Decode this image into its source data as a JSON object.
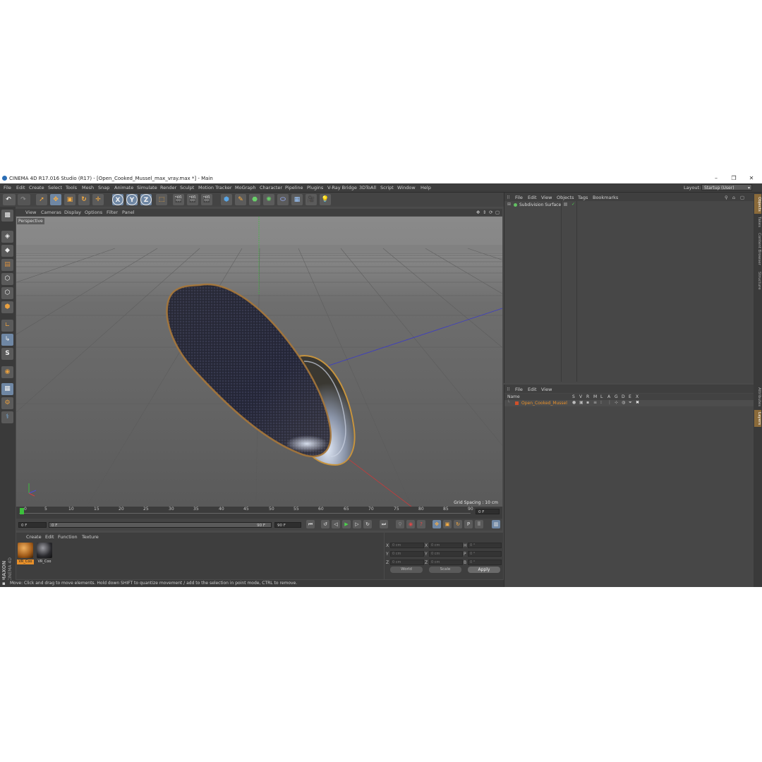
{
  "window": {
    "title": "CINEMA 4D R17.016 Studio (R17) - [Open_Cooked_Mussel_max_vray.max *] - Main",
    "minimize": "–",
    "restore": "❐",
    "close": "✕"
  },
  "menubar": {
    "items": [
      "File",
      "Edit",
      "Create",
      "Select",
      "Tools",
      "Mesh",
      "Snap",
      "Animate",
      "Simulate",
      "Render",
      "Sculpt",
      "Motion Tracker",
      "MoGraph",
      "Character",
      "Pipeline",
      "Plugins",
      "V-Ray Bridge",
      "3DToAll",
      "Script",
      "Window",
      "Help"
    ],
    "layout_label": "Layout:",
    "layout_value": "Startup (User)"
  },
  "toolbar": {
    "axis_x": "X",
    "axis_y": "Y",
    "axis_z": "Z"
  },
  "viewport": {
    "menu": [
      "View",
      "Cameras",
      "Display",
      "Options",
      "Filter",
      "Panel"
    ],
    "label": "Perspective",
    "grid_spacing": "Grid Spacing : 10 cm"
  },
  "timeline": {
    "ticks": [
      "0",
      "5",
      "10",
      "15",
      "20",
      "25",
      "30",
      "35",
      "40",
      "45",
      "50",
      "55",
      "60",
      "65",
      "70",
      "75",
      "80",
      "85",
      "90"
    ],
    "current_frame_right": "0 F",
    "start_frame": "0 F",
    "range_start": "0 F",
    "range_end": "90 F",
    "end_frame": "90 F"
  },
  "material_panel": {
    "menu": [
      "Create",
      "Edit",
      "Function",
      "Texture"
    ],
    "materials": [
      {
        "label": "VR_Coo",
        "color": "#b56a26"
      },
      {
        "label": "VR_Coo",
        "color": "#2b2b2b"
      }
    ]
  },
  "coordinates": {
    "pos_labels": [
      "X",
      "Y",
      "Z"
    ],
    "size_labels": [
      "X",
      "Y",
      "Z"
    ],
    "rot_labels": [
      "H",
      "P",
      "B"
    ],
    "pos_values": [
      "0 cm",
      "0 cm",
      "0 cm"
    ],
    "size_values": [
      "0 cm",
      "0 cm",
      "0 cm"
    ],
    "rot_values": [
      "0 °",
      "0 °",
      "0 °"
    ],
    "mode": "World",
    "type": "Scale",
    "apply": "Apply"
  },
  "status": {
    "text": "Move: Click and drag to move elements. Hold down SHIFT to quantize movement / add to the selection in point mode, CTRL to remove."
  },
  "object_manager": {
    "menu": [
      "File",
      "Edit",
      "View",
      "Objects",
      "Tags",
      "Bookmarks"
    ],
    "objects": [
      {
        "name": "Subdivision Surface"
      }
    ]
  },
  "layer_manager": {
    "menu": [
      "File",
      "Edit",
      "View"
    ],
    "header_name": "Name",
    "header_flags": [
      "S",
      "V",
      "R",
      "M",
      "L",
      "A",
      "G",
      "D",
      "E",
      "X"
    ],
    "layers": [
      {
        "name": "Open_Cooked_Mussel"
      }
    ]
  },
  "right_tabs": [
    "Objects",
    "Takes",
    "Content Browser",
    "Structure",
    "Attributes",
    "Layers"
  ],
  "brand": {
    "maxon": "MAXON",
    "cinema": "CINEMA 4D"
  },
  "colors": {
    "accent_orange": "#e8902a",
    "selection_blue": "#6f87a4",
    "layer_name": "#e8902a"
  }
}
